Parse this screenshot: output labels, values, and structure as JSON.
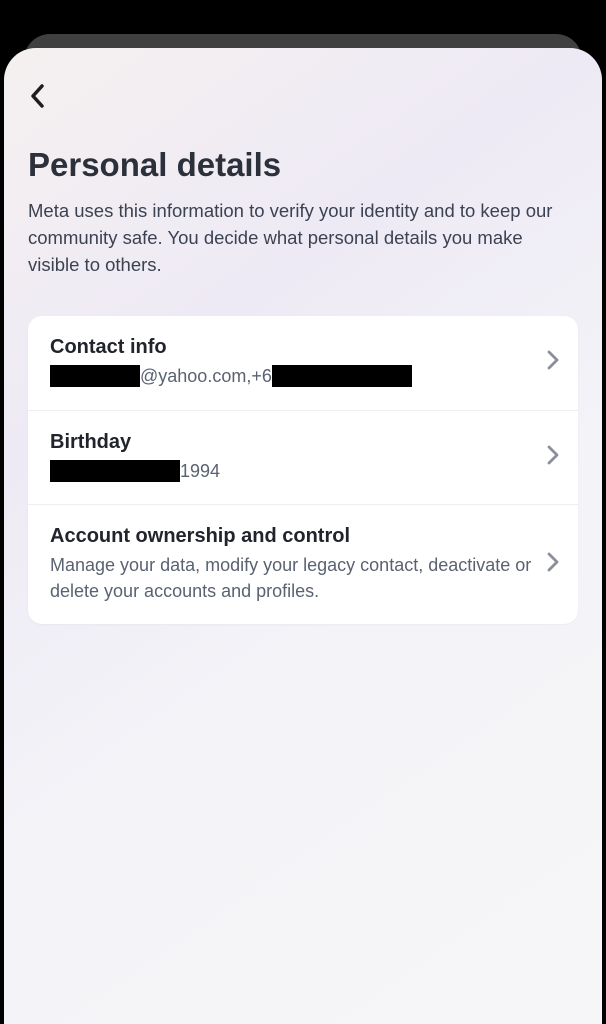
{
  "page": {
    "title": "Personal details",
    "description": "Meta uses this information to verify your identity and to keep our community safe. You decide what personal details you make visible to others."
  },
  "items": {
    "contact": {
      "title": "Contact info",
      "email_suffix": "@yahoo.com, ",
      "phone_prefix": "+6"
    },
    "birthday": {
      "title": "Birthday",
      "year": " 1994"
    },
    "ownership": {
      "title": "Account ownership and control",
      "description": "Manage your data, modify your legacy contact, deactivate or delete your accounts and profiles."
    }
  },
  "redaction_widths": {
    "contact_email_user": "90px",
    "contact_phone_rest": "140px",
    "birthday_date": "130px"
  }
}
